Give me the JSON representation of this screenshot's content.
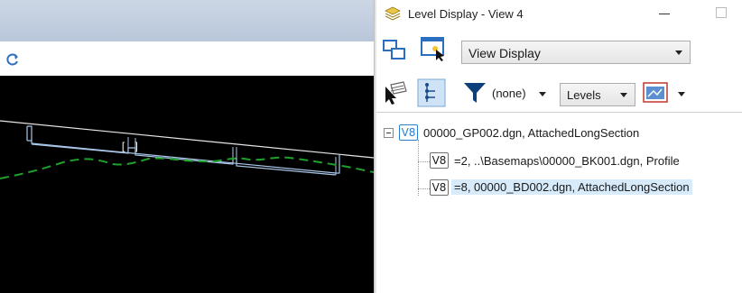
{
  "window": {
    "title": "Level Display - View 4",
    "icon": "layers-icon"
  },
  "toolbar": {
    "display_mode": {
      "selected": "View Display"
    },
    "filter": {
      "value": "(none)"
    },
    "levels_dropdown": {
      "selected": "Levels"
    }
  },
  "tree": {
    "root": {
      "badge": "V8",
      "label": "00000_GP002.dgn, AttachedLongSection",
      "children": [
        {
          "badge": "V8",
          "label": "=2, ..\\Basemaps\\00000_BK001.dgn, Profile"
        },
        {
          "badge": "V8",
          "label": "=8, 00000_BD002.dgn, AttachedLongSection",
          "selected": true
        }
      ]
    }
  },
  "colors": {
    "cad_background": "#000000",
    "profile_line": "#1fa02a",
    "section_line": "#a9c7e8",
    "selection": "#d7ebfb",
    "v8_accent": "#2a80d2"
  }
}
